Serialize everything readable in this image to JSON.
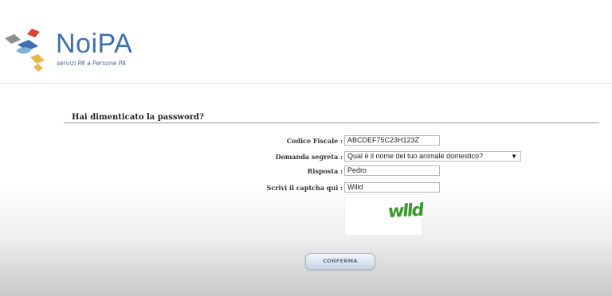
{
  "header": {
    "brand": "NoiPA",
    "tagline": "servizi PA a Persone PA"
  },
  "form": {
    "title": "Hai dimenticato la password?",
    "codice_fiscale": {
      "label": "Codice Fiscale :",
      "value": "ABCDEF75C23H123Z"
    },
    "domanda_segreta": {
      "label": "Domanda segreta :",
      "value": "Qual è il nome del tuo animale domestico?"
    },
    "risposta": {
      "label": "Risposta :",
      "value": "Pedro"
    },
    "captcha_input": {
      "label": "Scrivi il captcha qui :",
      "value": "Willd"
    },
    "captcha_image_text": "wlld",
    "confirm_label": "CONFERMA"
  },
  "colors": {
    "brand_blue": "#3e6fb0",
    "captcha_green": "#3a9a2e",
    "logo_red": "#d9443a",
    "logo_yellow": "#e9b84a",
    "logo_grey": "#8a8f96"
  }
}
